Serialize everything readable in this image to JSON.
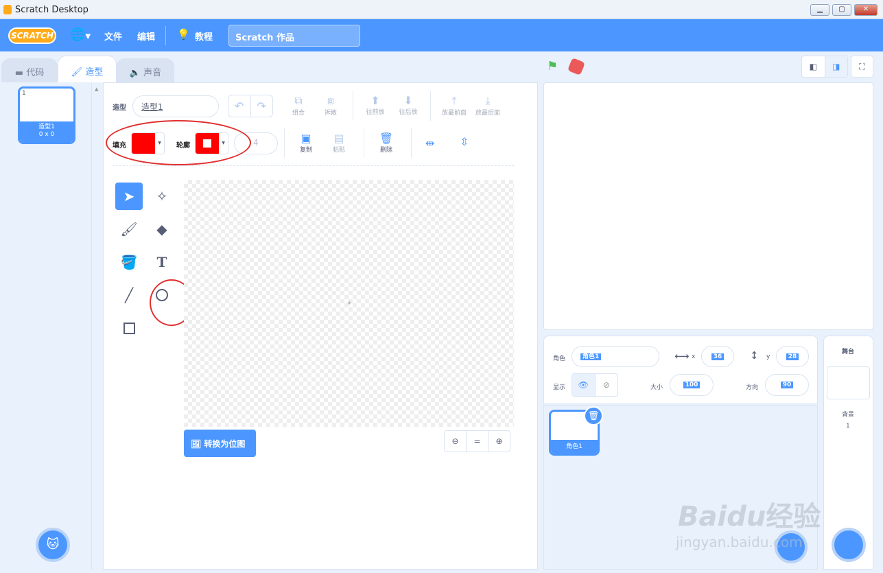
{
  "window": {
    "title": "Scratch Desktop",
    "min": "▁",
    "max": "▢",
    "close": "✕"
  },
  "menu": {
    "logo": "SCRATCH",
    "file": "文件",
    "edit": "编辑",
    "tutorials": "教程",
    "project_title": "Scratch 作品"
  },
  "tabs": {
    "code": "代码",
    "costumes": "造型",
    "sounds": "声音"
  },
  "costume": {
    "index": "1",
    "name": "造型1",
    "size": "0 x 0"
  },
  "editor": {
    "costume_label": "造型",
    "costume_name": "造型1",
    "group": "组合",
    "ungroup": "拆散",
    "forward": "往前放",
    "backward": "往后放",
    "front": "放最前面",
    "back": "放最后面",
    "fill_label": "填充",
    "outline_label": "轮廓",
    "outline_width": "4",
    "copy": "复制",
    "paste": "粘贴",
    "delete": "删除",
    "convert_bitmap": "转换为位图",
    "fill_color": "#ff0000",
    "outline_color": "#ff0000"
  },
  "sprite": {
    "label": "角色",
    "name": "角色1",
    "x_label": "x",
    "x": "36",
    "y_label": "y",
    "y": "28",
    "show_label": "显示",
    "size_label": "大小",
    "size": "100",
    "direction_label": "方向",
    "direction": "90",
    "thumb_name": "角色1"
  },
  "stage_pane": {
    "title": "舞台",
    "backdrops_label": "背景",
    "backdrops_count": "1"
  },
  "watermark": {
    "brand": "Bai",
    "du": "du",
    "cn": "经验",
    "url": "jingyan.baidu.com"
  }
}
